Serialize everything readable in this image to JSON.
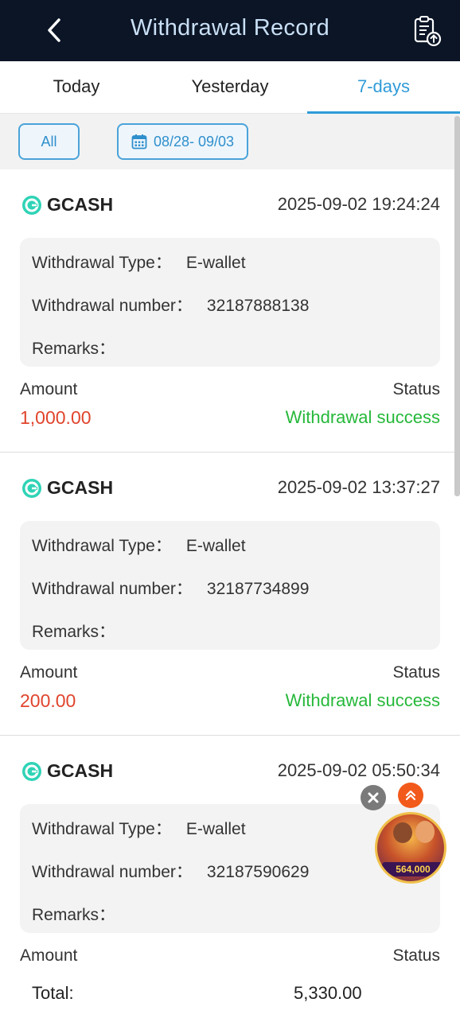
{
  "header": {
    "title": "Withdrawal Record"
  },
  "tabs": [
    {
      "label": "Today",
      "active": false
    },
    {
      "label": "Yesterday",
      "active": false
    },
    {
      "label": "7-days",
      "active": true
    }
  ],
  "filters": {
    "all_label": "All",
    "date_range": "08/28- 09/03"
  },
  "labels": {
    "type": "Withdrawal Type：",
    "number": "Withdrawal number：",
    "remarks": "Remarks：",
    "amount": "Amount",
    "status": "Status"
  },
  "records": [
    {
      "provider": "GCASH",
      "datetime": "2025-09-02 19:24:24",
      "type": "E-wallet",
      "number": "32187888138",
      "remarks": "",
      "amount": "1,000.00",
      "status": "Withdrawal success"
    },
    {
      "provider": "GCASH",
      "datetime": "2025-09-02 13:37:27",
      "type": "E-wallet",
      "number": "32187734899",
      "remarks": "",
      "amount": "200.00",
      "status": "Withdrawal success"
    },
    {
      "provider": "GCASH",
      "datetime": "2025-09-02 05:50:34",
      "type": "E-wallet",
      "number": "32187590629",
      "remarks": "",
      "amount": "",
      "status": ""
    }
  ],
  "footer": {
    "total_label": "Total:",
    "total_value": "5,330.00"
  },
  "promo": {
    "badge_text": "564,000"
  },
  "colors": {
    "header_bg": "#0b1526",
    "accent": "#2f9bd8",
    "amount": "#e0442c",
    "success": "#26b83a"
  },
  "icons": [
    "back-chevron-icon",
    "clipboard-upload-icon",
    "calendar-icon",
    "gcash-logo-icon",
    "close-icon",
    "double-chevron-up-icon"
  ]
}
